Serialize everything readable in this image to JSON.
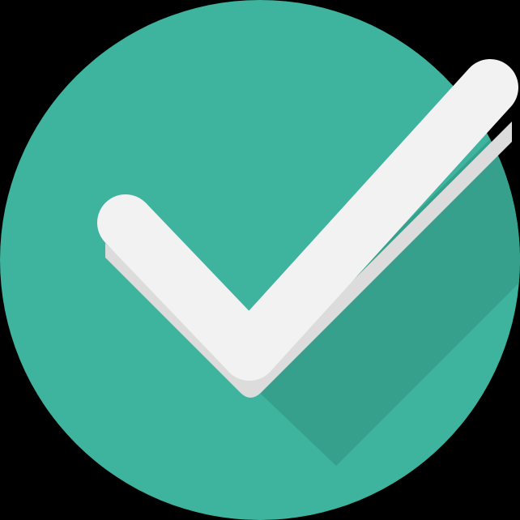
{
  "icon": {
    "name": "checkmark-circle-icon",
    "colors": {
      "background": "#000000",
      "circle": "#3EB39D",
      "circle_shadow": "#36A08C",
      "check_top": "#F2F2F2",
      "check_side": "#DCDCDC"
    }
  }
}
